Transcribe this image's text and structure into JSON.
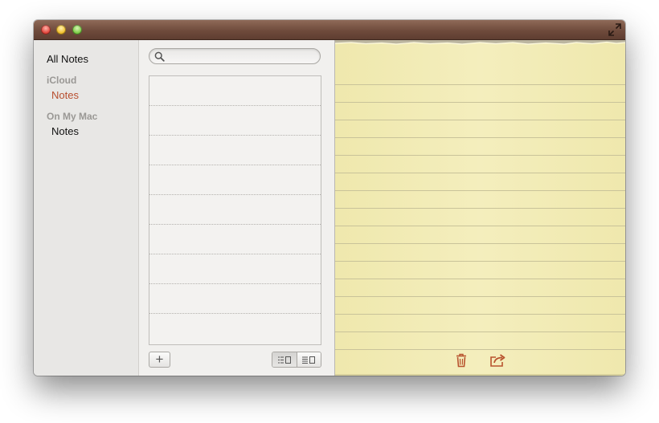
{
  "window": {
    "controls": [
      "close",
      "minimize",
      "zoom"
    ],
    "fullscreen_icon": "fullscreen-arrows-icon"
  },
  "sidebar": {
    "all_notes_label": "All Notes",
    "sections": [
      {
        "heading": "iCloud",
        "items": [
          {
            "label": "Notes",
            "selected": true
          }
        ]
      },
      {
        "heading": "On My Mac",
        "items": [
          {
            "label": "Notes",
            "selected": false
          }
        ]
      }
    ]
  },
  "search": {
    "value": "",
    "placeholder": "",
    "icon": "search-icon"
  },
  "notes_list": {
    "row_count": 9
  },
  "toolbar": {
    "add_label": "+",
    "view_modes": [
      "list-view-icon",
      "detail-view-icon"
    ],
    "active_view": "list-view-icon"
  },
  "note": {
    "body": "",
    "icons": [
      "trash-icon",
      "share-icon"
    ]
  },
  "colors": {
    "titlebar": "#6f4b3c",
    "selected_folder": "#b84f2f",
    "paper": "#f2ecb6",
    "paper_rule": "#c9c39a",
    "note_action": "#b8532e"
  }
}
